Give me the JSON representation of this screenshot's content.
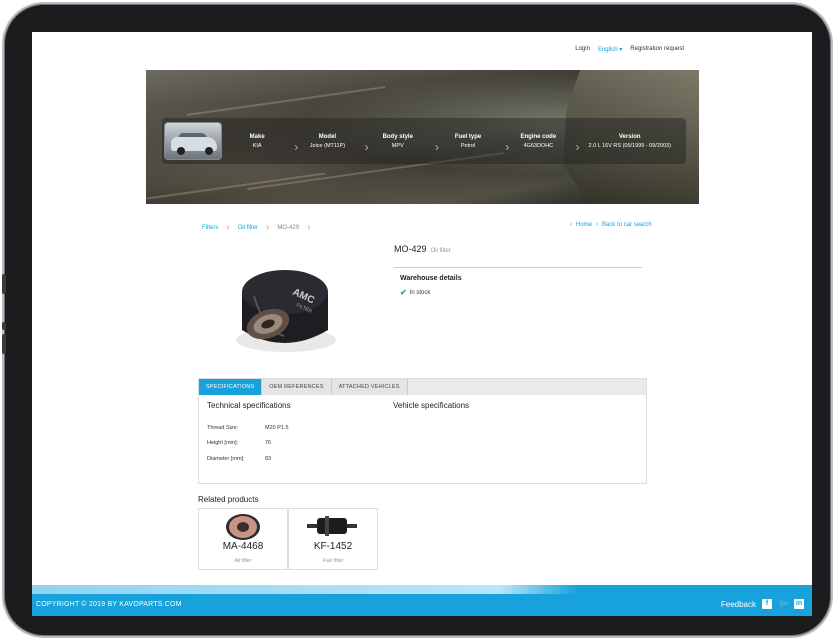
{
  "topnav": {
    "login": "Login",
    "language": "English ▾",
    "registration": "Registration request"
  },
  "vehicle": {
    "items": [
      {
        "key": "Make",
        "value": "KIA"
      },
      {
        "key": "Model",
        "value": "Joice (MT11P)"
      },
      {
        "key": "Body style",
        "value": "MPV"
      },
      {
        "key": "Fuel type",
        "value": "Petrol"
      },
      {
        "key": "Engine code",
        "value": "4G63DOHC"
      },
      {
        "key": "Version",
        "value": "2.0 L 16V RS (05/1999 - 09/2003)"
      }
    ]
  },
  "breadcrumb": {
    "filters": "Filters",
    "oil_filter": "Oil filter",
    "current": "MO-429"
  },
  "nav_links": {
    "home": "Home",
    "back": "Back to car search"
  },
  "product": {
    "code": "MO-429",
    "category": "Oil filter",
    "warehouse_title": "Warehouse details",
    "stock_status": "In stock"
  },
  "tabs": [
    "SPECIFICATIONS",
    "OEM REFERENCES",
    "ATTACHED VEHICLES"
  ],
  "specs": {
    "technical_title": "Technical specifications",
    "vehicle_title": "Vehicle specifications",
    "rows": [
      {
        "label": "Thread Size:",
        "value": "M20 P1.5"
      },
      {
        "label": "Height [mm]:",
        "value": "76"
      },
      {
        "label": "Diameter [mm]:",
        "value": "83"
      }
    ]
  },
  "related": {
    "title": "Related products",
    "items": [
      {
        "code": "MA-4468",
        "type": "Air filter"
      },
      {
        "code": "KF-1452",
        "type": "Fuel filter"
      }
    ]
  },
  "footer": {
    "copyright": "COPYRIGHT © 2019 BY KAVOPARTS.COM",
    "feedback": "Feedback"
  },
  "icons": {
    "check": "check-icon",
    "facebook": "facebook-icon",
    "twitter": "twitter-icon",
    "linkedin": "linkedin-icon"
  },
  "colors": {
    "accent": "#18a2dc",
    "link": "#1a9fe0",
    "stock": "#34a853"
  }
}
